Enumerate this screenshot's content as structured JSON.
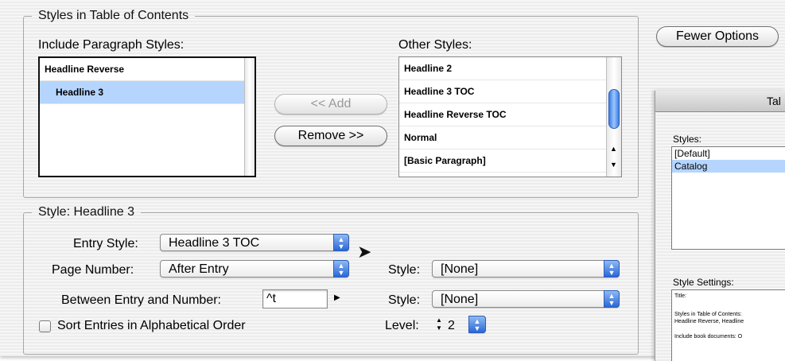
{
  "toc_styles_group": {
    "legend": "Styles in Table of Contents",
    "include_label": "Include Paragraph Styles:",
    "include_items": [
      {
        "label": "Headline Reverse",
        "selected": false
      },
      {
        "label": "Headline 3",
        "selected": true
      }
    ],
    "other_label": "Other Styles:",
    "other_items": [
      "Headline 2",
      "Headline 3 TOC",
      "Headline Reverse TOC",
      "Normal",
      "[Basic Paragraph]"
    ],
    "add_button": "<< Add",
    "remove_button": "Remove >>"
  },
  "fewer_options_button": "Fewer Options",
  "style_group": {
    "legend": "Style: Headline 3",
    "entry_style_label": "Entry Style:",
    "entry_style_value": "Headline 3 TOC",
    "page_number_label": "Page Number:",
    "page_number_value": "After Entry",
    "page_number_style_label": "Style:",
    "page_number_style_value": "[None]",
    "between_label": "Between Entry and Number:",
    "between_value": "^t",
    "between_style_label": "Style:",
    "between_style_value": "[None]",
    "sort_label": "Sort Entries in Alphabetical Order",
    "sort_checked": false,
    "level_label": "Level:",
    "level_value": "2"
  },
  "side_panel": {
    "title": "Tal",
    "styles_label": "Styles:",
    "styles_items": [
      {
        "label": "[Default]",
        "selected": false
      },
      {
        "label": "Catalog",
        "selected": true
      }
    ],
    "settings_label": "Style Settings:",
    "settings_lines": [
      "Title:",
      "Styles in Table of Contents:",
      "Headline Reverse, Headline",
      "Include book documents: O"
    ]
  },
  "colors": {
    "selection": "#b5d5ff",
    "accent": "#2a67d6"
  }
}
